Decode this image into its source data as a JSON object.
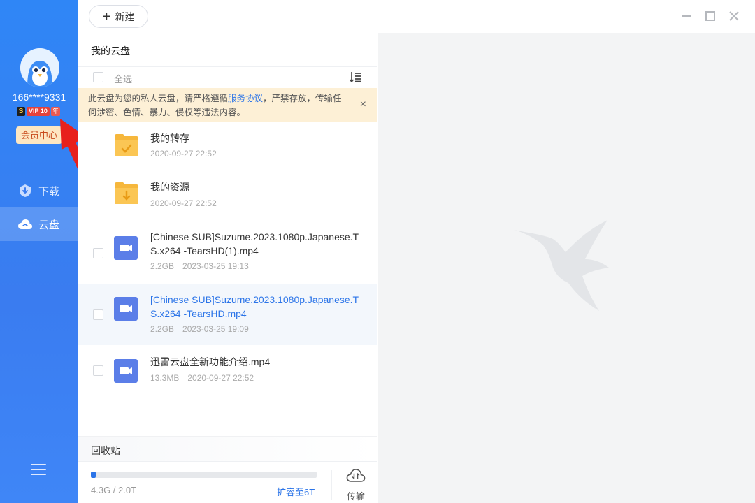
{
  "sidebar": {
    "username": "166****9331",
    "vip": {
      "s_badge": "S",
      "tag": "VIP 10",
      "year": "年"
    },
    "member_center": "会员中心",
    "nav": [
      {
        "label": "下载",
        "icon": "download-shield-icon"
      },
      {
        "label": "云盘",
        "icon": "cloud-icon"
      }
    ],
    "menu_icon": "hamburger-menu-icon"
  },
  "topbar": {
    "new_button": "新建",
    "window_controls": [
      "minimize-icon",
      "maximize-icon",
      "close-icon"
    ]
  },
  "panel": {
    "title": "我的云盘",
    "select_all": "全选",
    "notice": {
      "text_before": "此云盘为您的私人云盘，请严格遵循",
      "link": "服务协议",
      "text_after": "，严禁存放，传输任何涉密、色情、暴力、侵权等违法内容。",
      "close": "×"
    },
    "files": [
      {
        "name": "我的转存",
        "size": "",
        "date": "2020-09-27 22:52",
        "type": "folder-transfer"
      },
      {
        "name": "我的资源",
        "size": "",
        "date": "2020-09-27 22:52",
        "type": "folder-download"
      },
      {
        "name": "[Chinese SUB]Suzume.2023.1080p.Japanese.TS.x264 -TearsHD(1).mp4",
        "size": "2.2GB",
        "date": "2023-03-25 19:13",
        "type": "video"
      },
      {
        "name": "[Chinese SUB]Suzume.2023.1080p.Japanese.TS.x264 -TearsHD.mp4",
        "size": "2.2GB",
        "date": "2023-03-25 19:09",
        "type": "video",
        "selected": true
      },
      {
        "name": "迅雷云盘全新功能介绍.mp4",
        "size": "13.3MB",
        "date": "2020-09-27 22:52",
        "type": "video"
      }
    ],
    "recycle_bin": "回收站",
    "storage": {
      "used": "4.3G / 2.0T",
      "used_fraction": 0.0215,
      "expand": "扩容至6T",
      "transfer": "传输"
    }
  },
  "colors": {
    "sidebar": "#2f86f6",
    "accent": "#2b74e8",
    "notice_bg": "#fdf0d6",
    "folder": "#f6b73c",
    "video_icon": "#5b7ee8",
    "annotation_arrow": "#e8201c"
  }
}
